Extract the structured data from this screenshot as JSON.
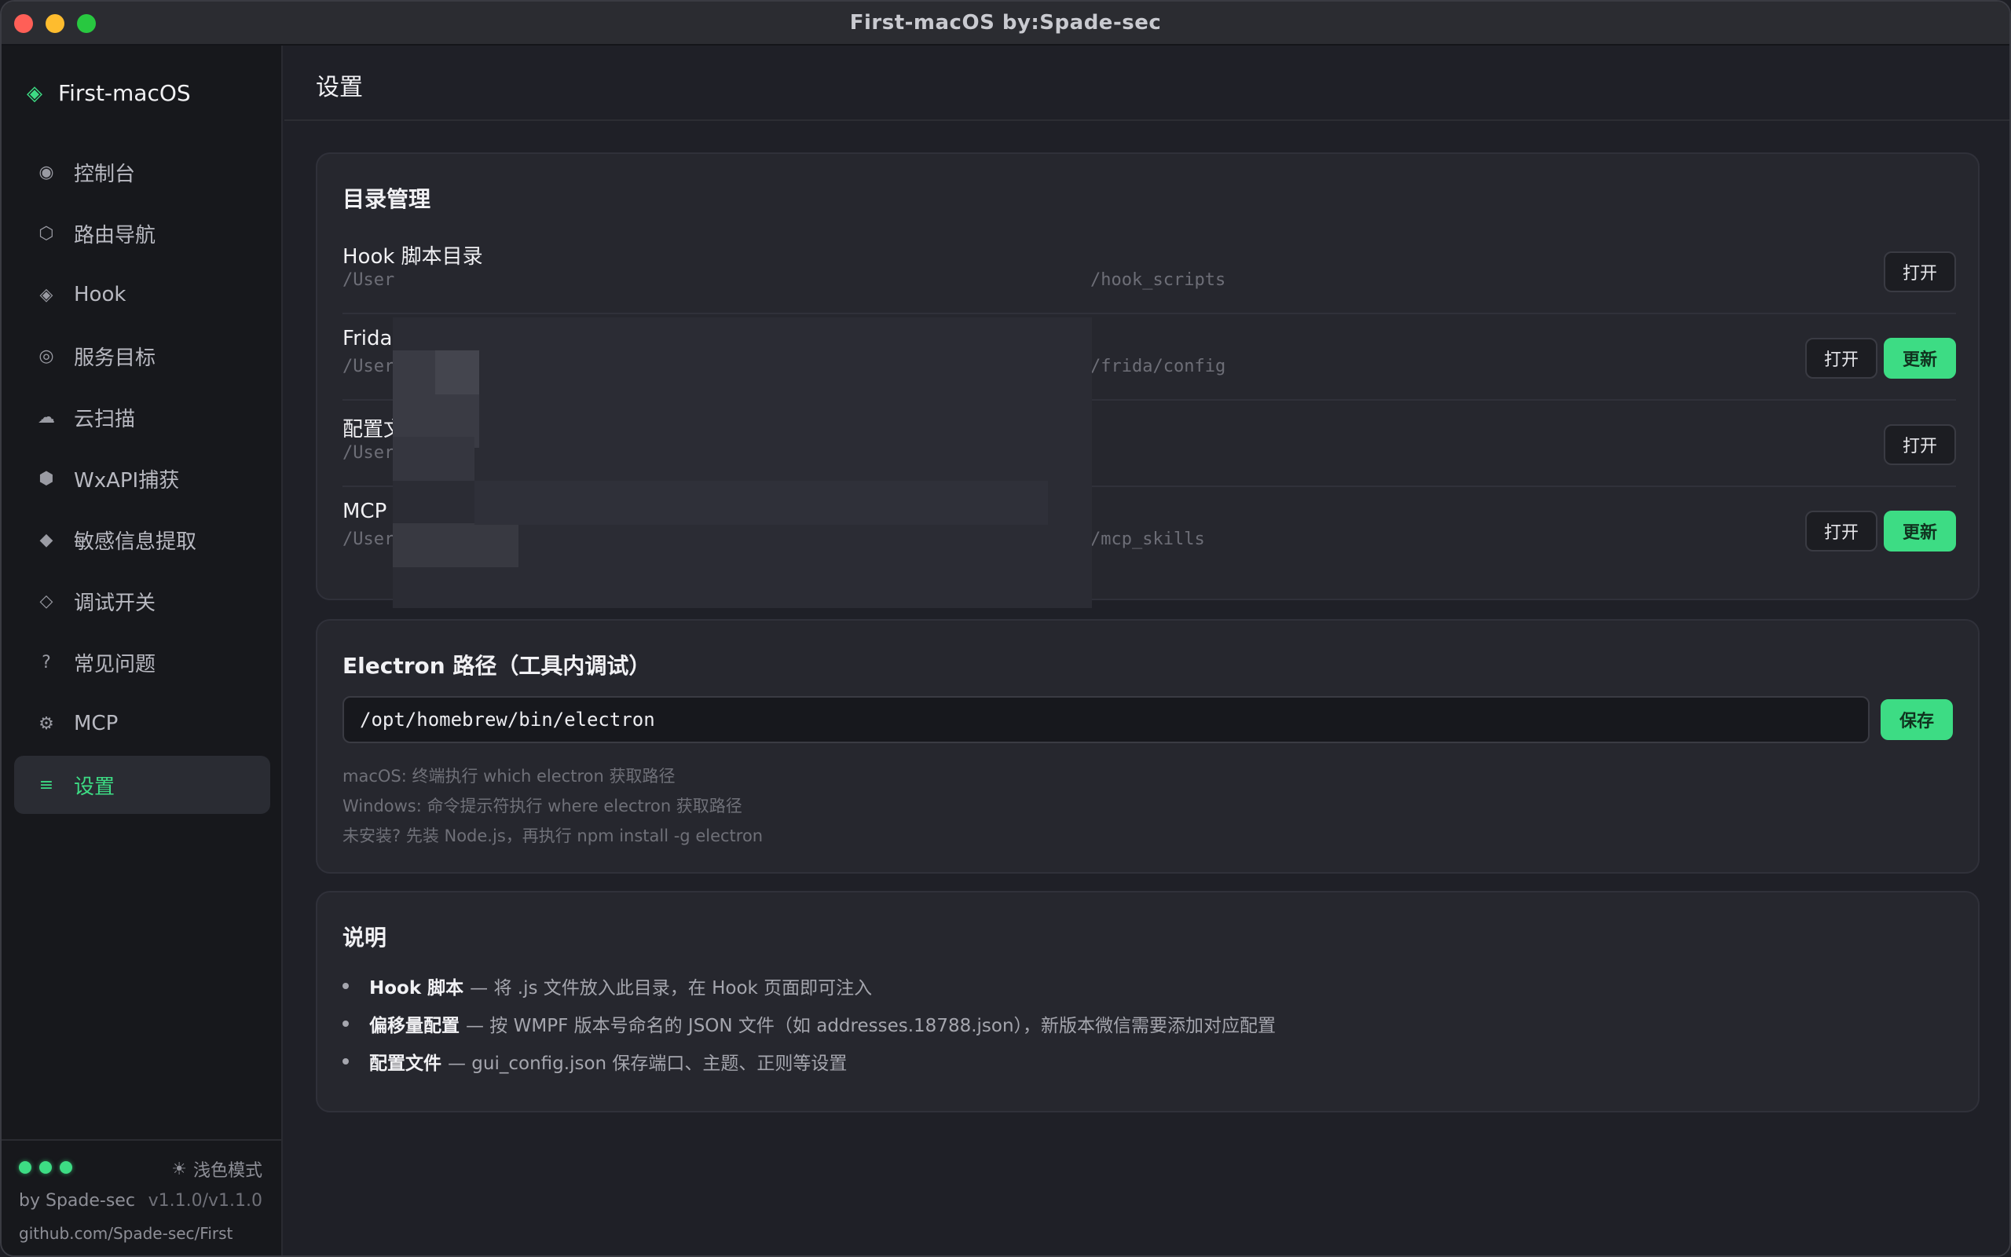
{
  "window": {
    "title": "First-macOS  by:Spade-sec"
  },
  "sidebar": {
    "brand": "First-macOS",
    "brand_icon": "diamond-icon",
    "items": [
      {
        "label": "控制台",
        "icon": "◉",
        "name": "console",
        "active": false
      },
      {
        "label": "路由导航",
        "icon": "⬡",
        "name": "route-nav",
        "active": false
      },
      {
        "label": "Hook",
        "icon": "◈",
        "name": "hook",
        "active": false
      },
      {
        "label": "服务目标",
        "icon": "◎",
        "name": "service-target",
        "active": false
      },
      {
        "label": "云扫描",
        "icon": "☁",
        "name": "cloud-scan",
        "active": false
      },
      {
        "label": "WxAPI捕获",
        "icon": "⬢",
        "name": "wxapi-capture",
        "active": false
      },
      {
        "label": "敏感信息提取",
        "icon": "◆",
        "name": "sensitive-extract",
        "active": false
      },
      {
        "label": "调试开关",
        "icon": "◇",
        "name": "debug-switch",
        "active": false
      },
      {
        "label": "常见问题",
        "icon": "?",
        "name": "faq",
        "active": false
      },
      {
        "label": "MCP",
        "icon": "⚙",
        "name": "mcp",
        "active": false
      },
      {
        "label": "设置",
        "icon": "≡",
        "name": "settings",
        "active": true
      }
    ],
    "footer": {
      "light_mode": "浅色模式",
      "by": "by Spade-sec",
      "version": "v1.1.0/v1.1.0",
      "github": "github.com/Spade-sec/First"
    }
  },
  "page": {
    "title": "设置"
  },
  "dirs": {
    "title": "目录管理",
    "rows": [
      {
        "name": "Hook 脚本目录",
        "path_start": "/User",
        "path_end": "/hook_scripts",
        "open": "打开",
        "update": ""
      },
      {
        "name": "Frida",
        "path_start": "/User",
        "path_end": "/frida/config",
        "open": "打开",
        "update": "更新"
      },
      {
        "name": "配置文",
        "path_start": "/User",
        "path_end": "",
        "open": "打开",
        "update": ""
      },
      {
        "name": "MCP",
        "path_start": "/User",
        "path_end": "/mcp_skills",
        "open": "打开",
        "update": "更新"
      }
    ]
  },
  "electron": {
    "title": "Electron 路径（工具内调试）",
    "value": "/opt/homebrew/bin/electron",
    "save": "保存",
    "hints": [
      "macOS: 终端执行 which electron 获取路径",
      "Windows: 命令提示符执行 where electron 获取路径",
      "未安装? 先装 Node.js，再执行 npm install -g electron"
    ]
  },
  "notes": {
    "title": "说明",
    "items": [
      {
        "key": "Hook 脚本",
        "text": "— 将 .js 文件放入此目录，在 Hook 页面即可注入"
      },
      {
        "key": "偏移量配置",
        "text": "— 按 WMPF 版本号命名的 JSON 文件（如 addresses.18788.json），新版本微信需要添加对应配置"
      },
      {
        "key": "配置文件",
        "text": "— gui_config.json 保存端口、主题、正则等设置"
      }
    ]
  },
  "colors": {
    "accent": "#3ddc84",
    "bg": "#1f2027",
    "sidebar": "#17181c",
    "card": "#26272e"
  }
}
